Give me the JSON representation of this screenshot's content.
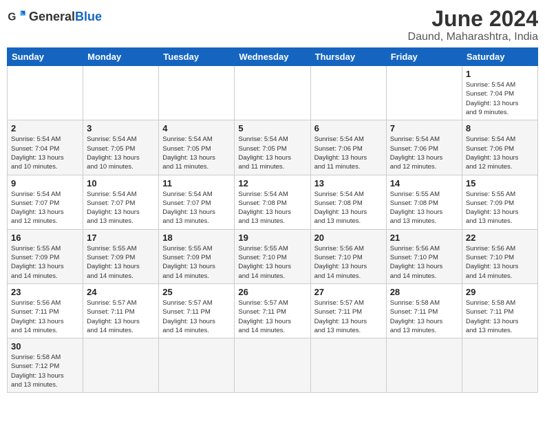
{
  "header": {
    "logo_general": "General",
    "logo_blue": "Blue",
    "title": "June 2024",
    "subtitle": "Daund, Maharashtra, India"
  },
  "days_of_week": [
    "Sunday",
    "Monday",
    "Tuesday",
    "Wednesday",
    "Thursday",
    "Friday",
    "Saturday"
  ],
  "weeks": [
    {
      "shade": "white",
      "days": [
        {
          "num": "",
          "info": ""
        },
        {
          "num": "",
          "info": ""
        },
        {
          "num": "",
          "info": ""
        },
        {
          "num": "",
          "info": ""
        },
        {
          "num": "",
          "info": ""
        },
        {
          "num": "",
          "info": ""
        },
        {
          "num": "1",
          "info": "Sunrise: 5:54 AM\nSunset: 7:04 PM\nDaylight: 13 hours\nand 9 minutes."
        }
      ]
    },
    {
      "shade": "shade",
      "days": [
        {
          "num": "2",
          "info": "Sunrise: 5:54 AM\nSunset: 7:04 PM\nDaylight: 13 hours\nand 10 minutes."
        },
        {
          "num": "3",
          "info": "Sunrise: 5:54 AM\nSunset: 7:05 PM\nDaylight: 13 hours\nand 10 minutes."
        },
        {
          "num": "4",
          "info": "Sunrise: 5:54 AM\nSunset: 7:05 PM\nDaylight: 13 hours\nand 11 minutes."
        },
        {
          "num": "5",
          "info": "Sunrise: 5:54 AM\nSunset: 7:05 PM\nDaylight: 13 hours\nand 11 minutes."
        },
        {
          "num": "6",
          "info": "Sunrise: 5:54 AM\nSunset: 7:06 PM\nDaylight: 13 hours\nand 11 minutes."
        },
        {
          "num": "7",
          "info": "Sunrise: 5:54 AM\nSunset: 7:06 PM\nDaylight: 13 hours\nand 12 minutes."
        },
        {
          "num": "8",
          "info": "Sunrise: 5:54 AM\nSunset: 7:06 PM\nDaylight: 13 hours\nand 12 minutes."
        }
      ]
    },
    {
      "shade": "white",
      "days": [
        {
          "num": "9",
          "info": "Sunrise: 5:54 AM\nSunset: 7:07 PM\nDaylight: 13 hours\nand 12 minutes."
        },
        {
          "num": "10",
          "info": "Sunrise: 5:54 AM\nSunset: 7:07 PM\nDaylight: 13 hours\nand 13 minutes."
        },
        {
          "num": "11",
          "info": "Sunrise: 5:54 AM\nSunset: 7:07 PM\nDaylight: 13 hours\nand 13 minutes."
        },
        {
          "num": "12",
          "info": "Sunrise: 5:54 AM\nSunset: 7:08 PM\nDaylight: 13 hours\nand 13 minutes."
        },
        {
          "num": "13",
          "info": "Sunrise: 5:54 AM\nSunset: 7:08 PM\nDaylight: 13 hours\nand 13 minutes."
        },
        {
          "num": "14",
          "info": "Sunrise: 5:55 AM\nSunset: 7:08 PM\nDaylight: 13 hours\nand 13 minutes."
        },
        {
          "num": "15",
          "info": "Sunrise: 5:55 AM\nSunset: 7:09 PM\nDaylight: 13 hours\nand 13 minutes."
        }
      ]
    },
    {
      "shade": "shade",
      "days": [
        {
          "num": "16",
          "info": "Sunrise: 5:55 AM\nSunset: 7:09 PM\nDaylight: 13 hours\nand 14 minutes."
        },
        {
          "num": "17",
          "info": "Sunrise: 5:55 AM\nSunset: 7:09 PM\nDaylight: 13 hours\nand 14 minutes."
        },
        {
          "num": "18",
          "info": "Sunrise: 5:55 AM\nSunset: 7:09 PM\nDaylight: 13 hours\nand 14 minutes."
        },
        {
          "num": "19",
          "info": "Sunrise: 5:55 AM\nSunset: 7:10 PM\nDaylight: 13 hours\nand 14 minutes."
        },
        {
          "num": "20",
          "info": "Sunrise: 5:56 AM\nSunset: 7:10 PM\nDaylight: 13 hours\nand 14 minutes."
        },
        {
          "num": "21",
          "info": "Sunrise: 5:56 AM\nSunset: 7:10 PM\nDaylight: 13 hours\nand 14 minutes."
        },
        {
          "num": "22",
          "info": "Sunrise: 5:56 AM\nSunset: 7:10 PM\nDaylight: 13 hours\nand 14 minutes."
        }
      ]
    },
    {
      "shade": "white",
      "days": [
        {
          "num": "23",
          "info": "Sunrise: 5:56 AM\nSunset: 7:11 PM\nDaylight: 13 hours\nand 14 minutes."
        },
        {
          "num": "24",
          "info": "Sunrise: 5:57 AM\nSunset: 7:11 PM\nDaylight: 13 hours\nand 14 minutes."
        },
        {
          "num": "25",
          "info": "Sunrise: 5:57 AM\nSunset: 7:11 PM\nDaylight: 13 hours\nand 14 minutes."
        },
        {
          "num": "26",
          "info": "Sunrise: 5:57 AM\nSunset: 7:11 PM\nDaylight: 13 hours\nand 14 minutes."
        },
        {
          "num": "27",
          "info": "Sunrise: 5:57 AM\nSunset: 7:11 PM\nDaylight: 13 hours\nand 13 minutes."
        },
        {
          "num": "28",
          "info": "Sunrise: 5:58 AM\nSunset: 7:11 PM\nDaylight: 13 hours\nand 13 minutes."
        },
        {
          "num": "29",
          "info": "Sunrise: 5:58 AM\nSunset: 7:11 PM\nDaylight: 13 hours\nand 13 minutes."
        }
      ]
    },
    {
      "shade": "shade",
      "days": [
        {
          "num": "30",
          "info": "Sunrise: 5:58 AM\nSunset: 7:12 PM\nDaylight: 13 hours\nand 13 minutes."
        },
        {
          "num": "",
          "info": ""
        },
        {
          "num": "",
          "info": ""
        },
        {
          "num": "",
          "info": ""
        },
        {
          "num": "",
          "info": ""
        },
        {
          "num": "",
          "info": ""
        },
        {
          "num": "",
          "info": ""
        }
      ]
    }
  ]
}
